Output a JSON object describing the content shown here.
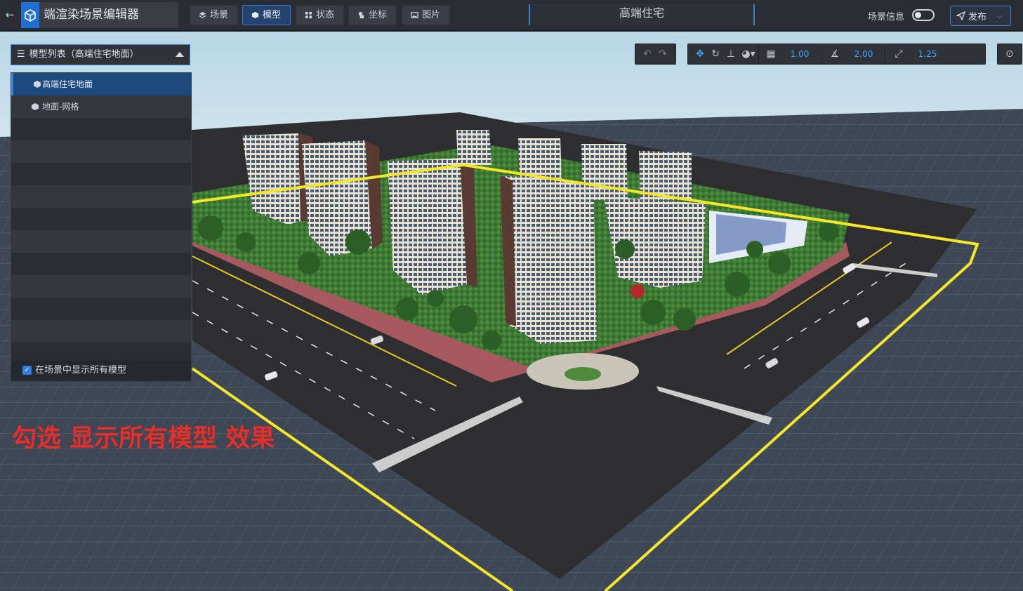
{
  "app": {
    "name": "端渲染场景编辑器"
  },
  "nav": [
    {
      "label": "场景",
      "icon": "layers-icon",
      "active": false
    },
    {
      "label": "模型",
      "icon": "cube-icon",
      "active": true
    },
    {
      "label": "状态",
      "icon": "grid-icon",
      "active": false
    },
    {
      "label": "坐标",
      "icon": "coordinate-icon",
      "active": false
    },
    {
      "label": "图片",
      "icon": "image-icon",
      "active": false
    }
  ],
  "scene_title": "高端住宅",
  "header": {
    "scene_info_label": "场景信息",
    "scene_info_toggle": false,
    "publish_label": "发布"
  },
  "model_list": {
    "title": "模型列表（高端住宅地面）",
    "items": [
      {
        "label": "高端住宅地面",
        "selected": true
      },
      {
        "label": "地面-网格",
        "selected": false
      }
    ],
    "show_all_label": "在场景中显示所有模型",
    "show_all_checked": true
  },
  "toolbar": {
    "grid_snap": "1.00",
    "angle_snap": "2.00",
    "scale_snap": "1.25"
  },
  "annotation": {
    "text": "勾选 显示所有模型 效果"
  },
  "colors": {
    "accent": "#3c7fd0",
    "selection_outline": "#f4e629",
    "annotation": "#e0312c"
  }
}
